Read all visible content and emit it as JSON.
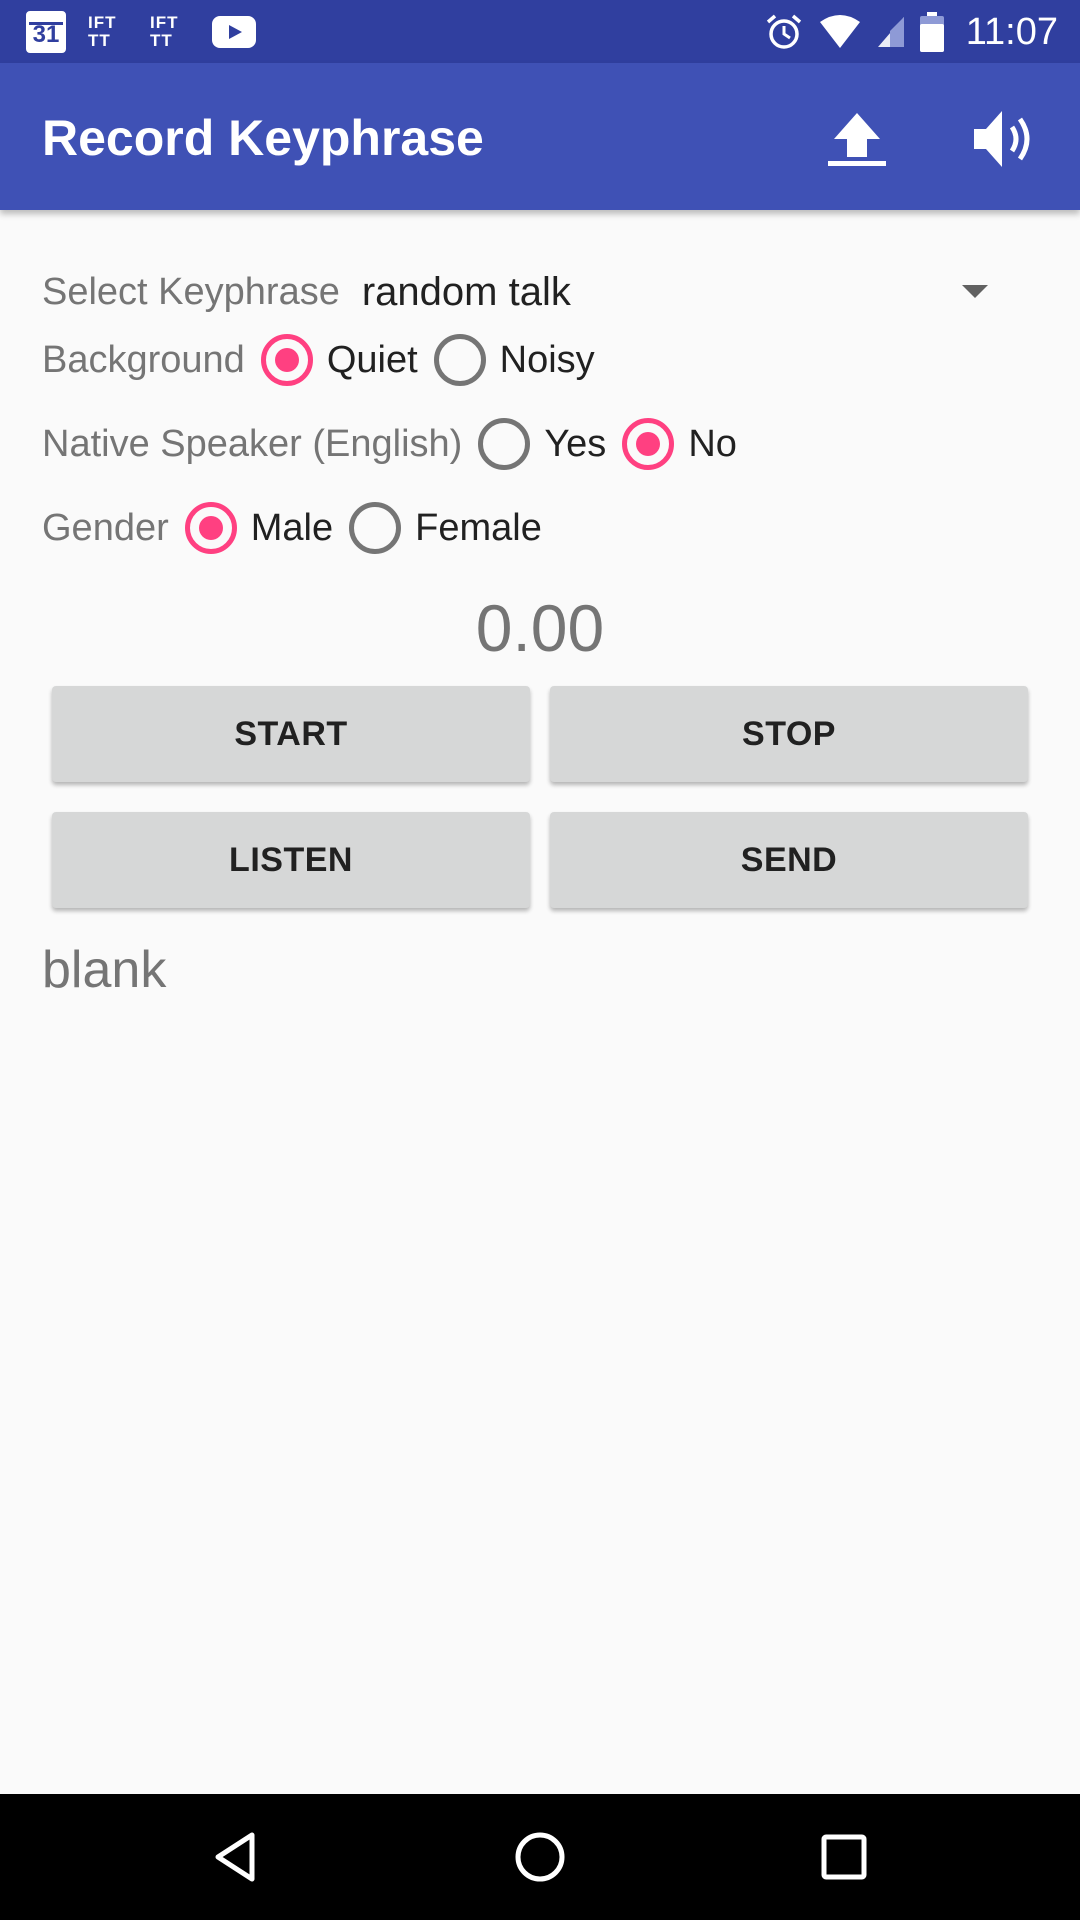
{
  "status_bar": {
    "calendar_day": "31",
    "ifttt_line1": "IFT",
    "ifttt_line2": "TT",
    "time": "11:07",
    "icons": [
      "calendar-icon",
      "ifttt-icon",
      "ifttt-icon",
      "youtube-icon",
      "alarm-icon",
      "wifi-icon",
      "signal-icon",
      "battery-icon"
    ]
  },
  "app_bar": {
    "title": "Record Keyphrase",
    "actions": [
      "upload-icon",
      "volume-icon"
    ]
  },
  "form": {
    "keyphrase": {
      "label": "Select Keyphrase",
      "value": "random talk"
    },
    "background": {
      "label": "Background",
      "options": [
        "Quiet",
        "Noisy"
      ],
      "selected": "Quiet"
    },
    "native_speaker": {
      "label": "Native Speaker (English)",
      "options": [
        "Yes",
        "No"
      ],
      "selected": "No"
    },
    "gender": {
      "label": "Gender",
      "options": [
        "Male",
        "Female"
      ],
      "selected": "Male"
    }
  },
  "timer": "0.00",
  "buttons": {
    "start": "START",
    "stop": "STOP",
    "listen": "LISTEN",
    "send": "SEND"
  },
  "result_text": "blank",
  "nav_bar": {
    "icons": [
      "back-icon",
      "home-icon",
      "recents-icon"
    ]
  },
  "colors": {
    "primary": "#3f51b5",
    "primary_dark": "#303f9f",
    "accent": "#ff4081"
  }
}
